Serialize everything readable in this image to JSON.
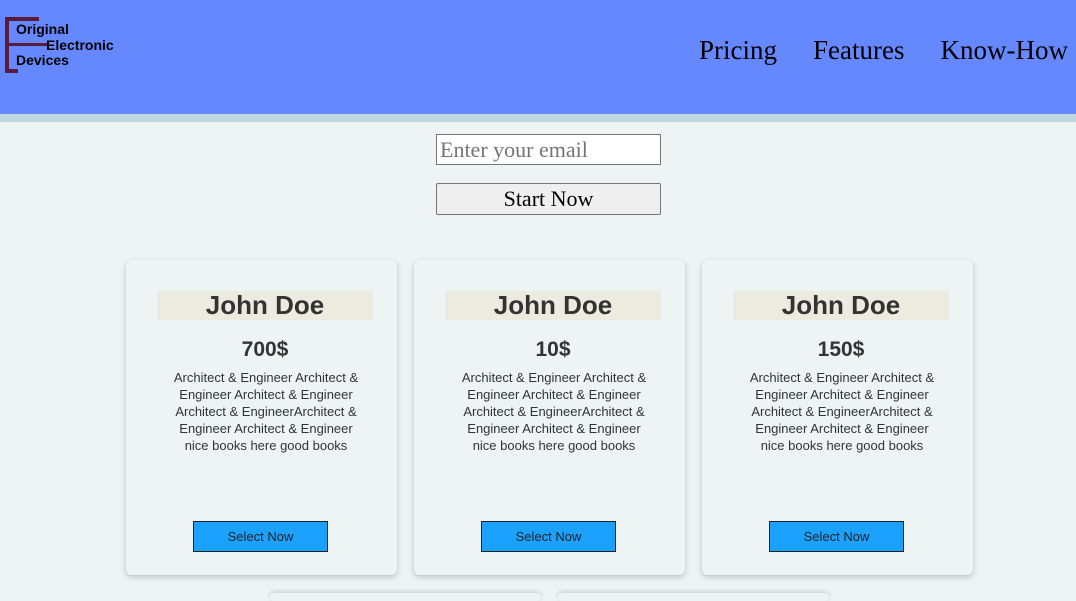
{
  "brand": {
    "logo_lines": [
      "Original",
      "Electronic",
      "Devices"
    ]
  },
  "nav": {
    "items": [
      "Pricing",
      "Features",
      "Know-How"
    ]
  },
  "signup": {
    "email_placeholder": "Enter your email",
    "start_label": "Start Now"
  },
  "cards": [
    {
      "name": "John Doe",
      "price": "700$",
      "description": "Architect & Engineer Architect & Engineer Architect & Engineer Architect & EngineerArchitect & Engineer Architect & Engineer nice books here good books",
      "button": "Select Now"
    },
    {
      "name": "John Doe",
      "price": "10$",
      "description": "Architect & Engineer Architect & Engineer Architect & Engineer Architect & EngineerArchitect & Engineer Architect & Engineer nice books here good books",
      "button": "Select Now"
    },
    {
      "name": "John Doe",
      "price": "150$",
      "description": "Architect & Engineer Architect & Engineer Architect & Engineer Architect & EngineerArchitect & Engineer Architect & Engineer nice books here good books",
      "button": "Select Now"
    }
  ],
  "colors": {
    "header_bg": "#6688ff",
    "header_strip": "#bfd6dd",
    "page_bg": "#eef4f4",
    "logo_accent": "#5a1b3a",
    "card_name_bg": "#ebebe0",
    "select_button_bg": "#1ba1ff"
  }
}
